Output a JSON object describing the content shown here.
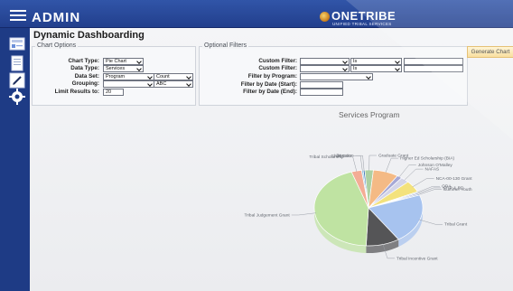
{
  "header": {
    "title": "ADMIN",
    "brand_name": "ONETRIBE",
    "brand_subtitle": "UNIFIED TRIBAL SERVICES"
  },
  "page": {
    "title": "Dynamic Dashboarding"
  },
  "chart_options": {
    "legend": "Chart Options",
    "chart_type_label": "Chart Type:",
    "chart_type_value": "Pie Chart",
    "data_type_label": "Data Type:",
    "data_type_value": "Services",
    "data_set_label": "Data Set:",
    "data_set_value": "Program",
    "data_set_aggregate": "Count",
    "grouping_label": "Grouping:",
    "grouping_value": "",
    "grouping_sort": "ABC",
    "limit_label": "Limit Results to:",
    "limit_value": "20"
  },
  "optional_filters": {
    "legend": "Optional Filters",
    "custom_filter_label_1": "Custom Filter:",
    "custom_filter_field_1": "",
    "custom_filter_op_1": "Is",
    "custom_filter_value_1": "",
    "custom_filter_label_2": "Custom Filter:",
    "custom_filter_field_2": "",
    "custom_filter_op_2": "Is",
    "custom_filter_value_2": "",
    "program_label": "Filter by Program:",
    "program_value": "",
    "date_start_label": "Filter by Date (Start):",
    "date_start_value": "",
    "date_end_label": "Filter by Date (End):",
    "date_end_value": ""
  },
  "buttons": {
    "generate": "Generate Chart"
  },
  "chart_data": {
    "type": "pie",
    "title": "Services Program",
    "categories": [
      "Child Care",
      "Donation",
      "Graduate Grant",
      "Higher Ed Scholarship (BIA)",
      "Johnson O'Malley",
      "NAFAS",
      "NCA-00-130 Grant",
      "ODA",
      "STIP & RD",
      "Summer Youth",
      "Tribal Grant",
      "Tribal Incentive Grant",
      "Tribal Judgement Grant",
      "Tribal Scholarship"
    ],
    "values": [
      0.5,
      0.5,
      2.5,
      7.5,
      1.5,
      2.5,
      5,
      0.5,
      0.5,
      0.5,
      21,
      10,
      44,
      3
    ],
    "colors": [
      "#93c8e8",
      "#4678b7",
      "#acd0a2",
      "#f4ba85",
      "#a6a8d6",
      "#d4d5e8",
      "#f3e27d",
      "#c2dcea",
      "#8d8dbd",
      "#8fb3db",
      "#a7c3ef",
      "#555557",
      "#bfe3a2",
      "#f4ad95"
    ],
    "grid": false,
    "legend": "none"
  }
}
